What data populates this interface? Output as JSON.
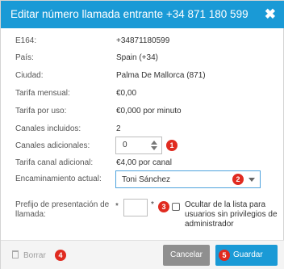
{
  "header": {
    "title": "Editar número llamada entrante +34 871 180 599",
    "close_icon": "close-icon"
  },
  "info": [
    {
      "label": "E164:",
      "value": "+34871180599"
    },
    {
      "label": "País:",
      "value": "Spain (+34)"
    },
    {
      "label": "Ciudad:",
      "value": "Palma De Mallorca (871)"
    },
    {
      "label": "Tarifa mensual:",
      "value": "€0,00"
    },
    {
      "label": "Tarifa por uso:",
      "value": "€0,000 por minuto"
    },
    {
      "label": "Canales incluidos:",
      "value": "2"
    }
  ],
  "channels": {
    "label": "Canales adicionales:",
    "value": "0"
  },
  "extra_rate": {
    "label": "Tarifa canal adicional:",
    "value": "€4,00 por canal"
  },
  "routing": {
    "label": "Encaminamiento actual:",
    "value": "Toni Sánchez"
  },
  "prefix": {
    "label": "Prefijo de presentación de llamada:",
    "required_mark": "*",
    "value": "",
    "checkbox_label": "Ocultar de la lista para usuarios sin privilegios de administrador",
    "checkbox_checked": false
  },
  "footer": {
    "delete_label": "Borrar",
    "cancel_label": "Cancelar",
    "save_label": "Guardar"
  },
  "badges": [
    "1",
    "2",
    "3",
    "4",
    "5"
  ],
  "colors": {
    "accent": "#1a9ad6",
    "badge": "#e02b20",
    "cancel": "#8f8f8f"
  }
}
